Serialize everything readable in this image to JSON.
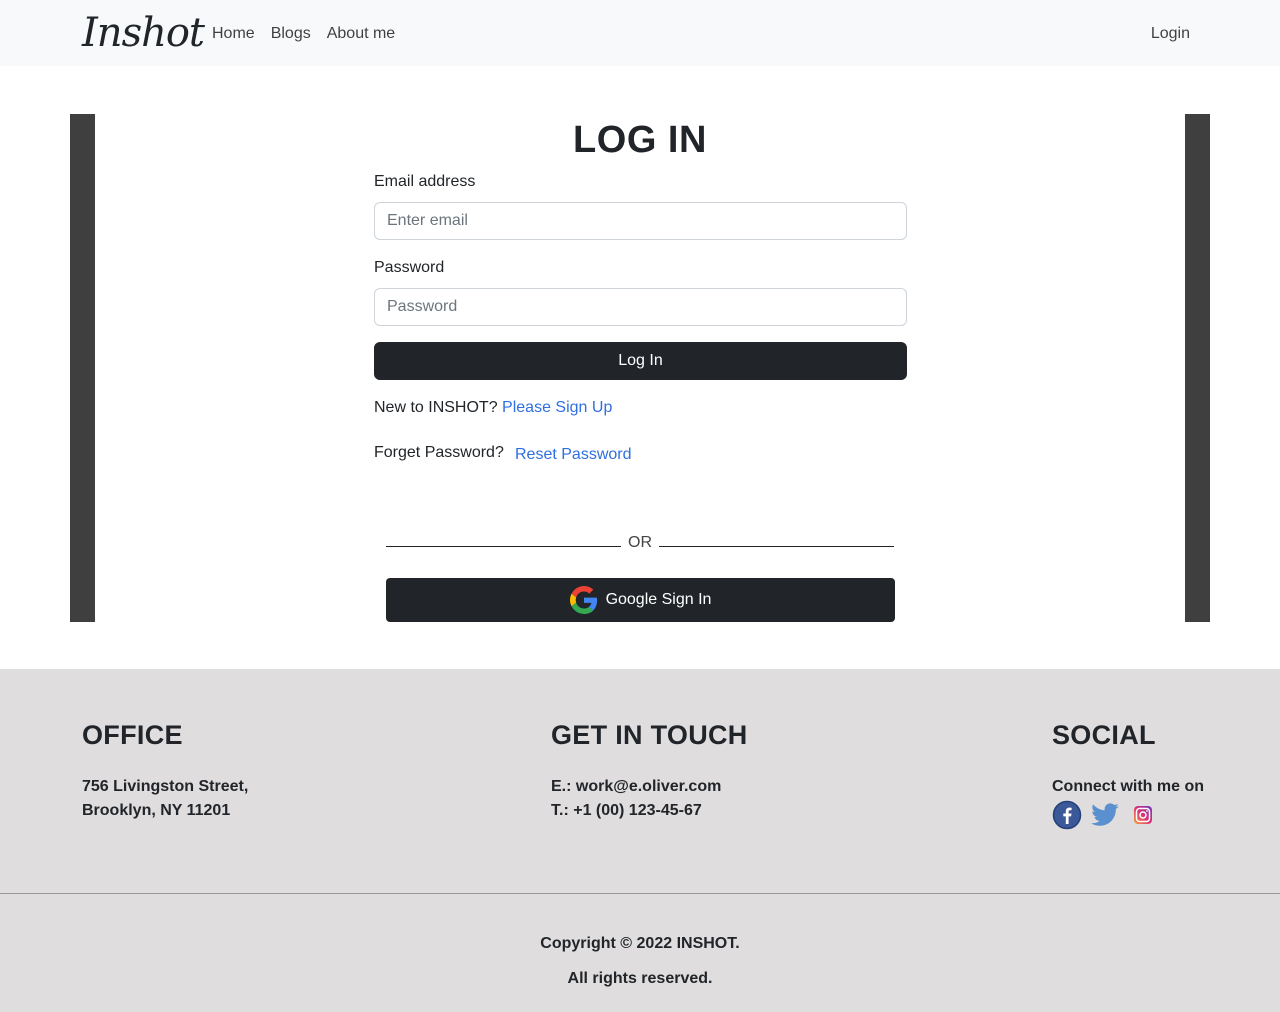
{
  "navbar": {
    "brand": "Inshot",
    "links": [
      "Home",
      "Blogs",
      "About me"
    ],
    "login": "Login"
  },
  "login_form": {
    "title": "LOG IN",
    "email_label": "Email address",
    "email_placeholder": "Enter email",
    "email_value": "",
    "password_label": "Password",
    "password_placeholder": "Password",
    "password_value": "",
    "submit_label": "Log In",
    "signup_prompt": "New to INSHOT?",
    "signup_link": "Please Sign Up",
    "forget_prompt": "Forget Password?",
    "reset_link": "Reset Password",
    "or_text": "OR",
    "google_label": "Google Sign In",
    "google_icon": "google-g-icon"
  },
  "colors": {
    "navbar_bg": "#f8f9fa",
    "button_bg": "#212529",
    "link": "#2f6fe0",
    "side_bar": "#3f3f3f",
    "footer_bg": "#dfddde"
  },
  "footer": {
    "office": {
      "heading": "OFFICE",
      "line1": "756 Livingston Street,",
      "line2": "Brooklyn, NY 11201"
    },
    "touch": {
      "heading": "GET IN TOUCH",
      "email": "E.: work@e.oliver.com",
      "phone": "T.: +1 (00) 123-45-67"
    },
    "social": {
      "heading": "SOCIAL",
      "text": "Connect with me on",
      "icons": [
        "facebook-icon",
        "twitter-icon",
        "instagram-icon"
      ]
    },
    "copyright": "Copyright © 2022 INSHOT.",
    "rights": "All rights reserved."
  }
}
